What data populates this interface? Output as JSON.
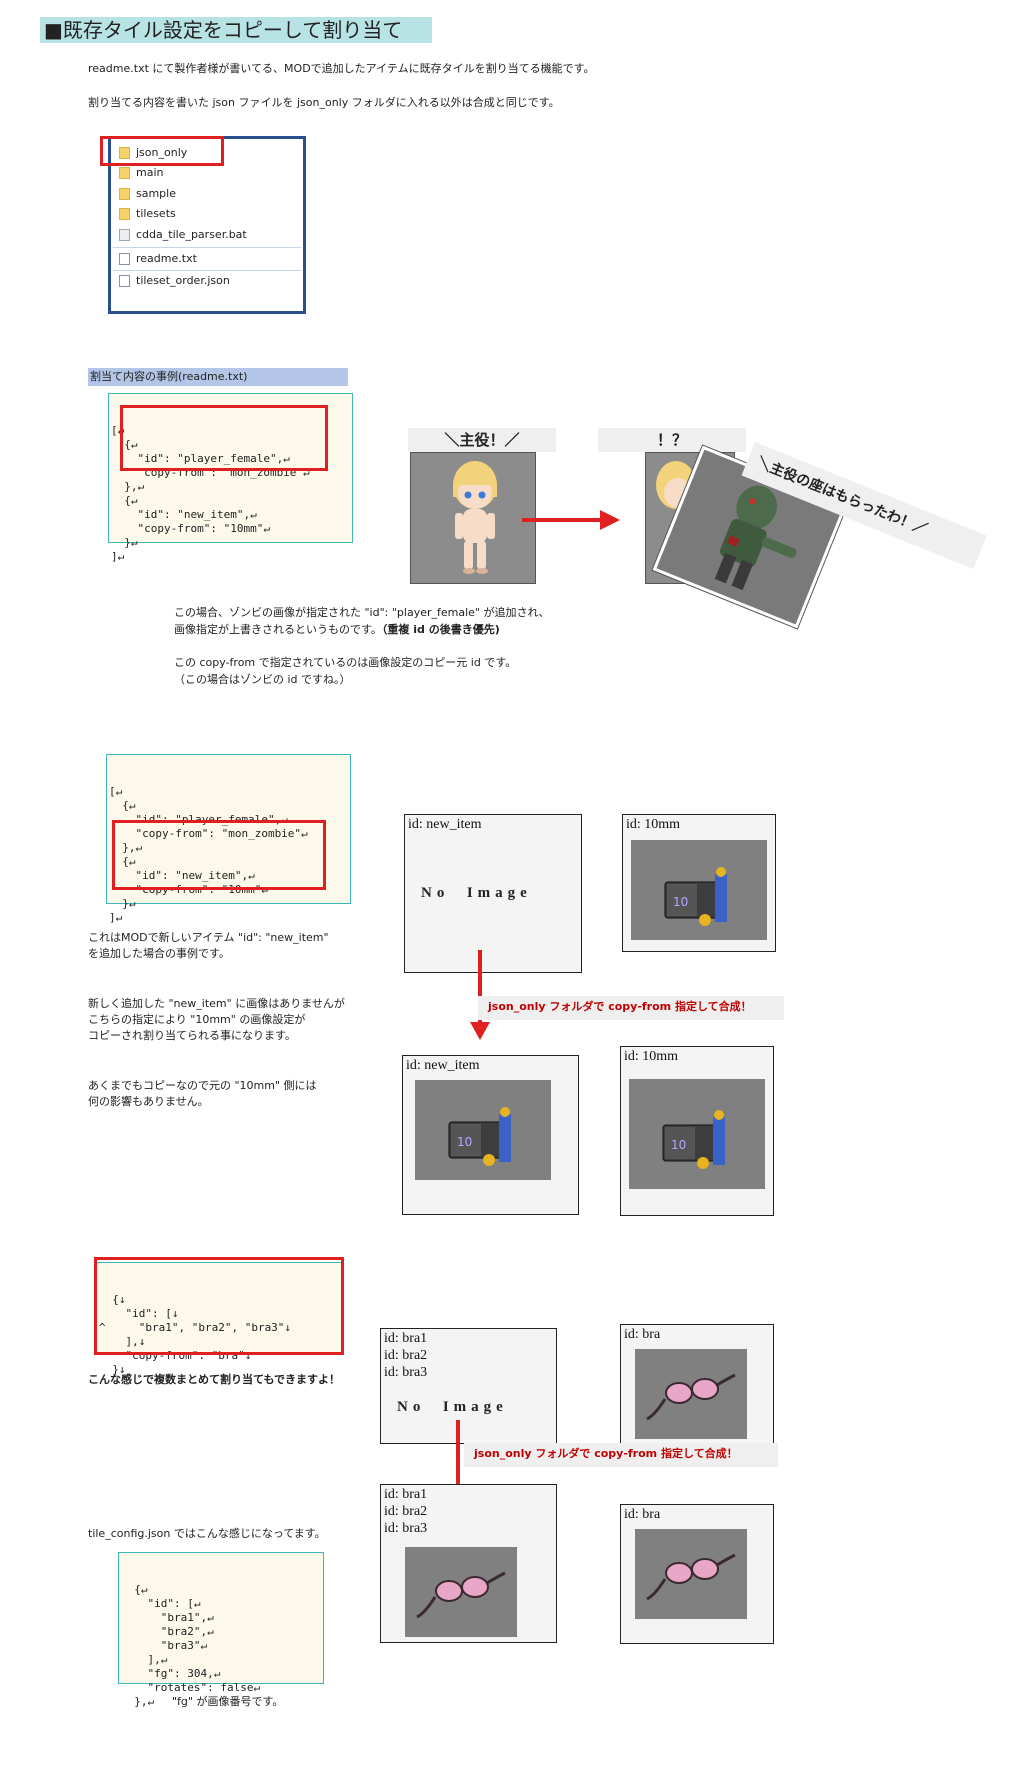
{
  "title": "■既存タイル設定をコピーして割り当て",
  "intro": {
    "line1": "readme.txt にて製作者様が書いてる、MODで追加したアイテムに既存タイルを割り当てる機能です。",
    "line2": "割り当てる内容を書いた json ファイルを json_only フォルダに入れる以外は合成と同じです。"
  },
  "folder": {
    "items": [
      {
        "name": "json_only",
        "icon": "folder-icon"
      },
      {
        "name": "main",
        "icon": "folder-icon"
      },
      {
        "name": "sample",
        "icon": "folder-icon"
      },
      {
        "name": "tilesets",
        "icon": "folder-icon"
      },
      {
        "name": "cdda_tile_parser.bat",
        "icon": "batch-file-icon"
      },
      {
        "name": "readme.txt",
        "icon": "text-file-icon"
      },
      {
        "name": "tileset_order.json",
        "icon": "json-file-icon"
      }
    ]
  },
  "section1": {
    "heading": "割当て内容の事例(readme.txt)",
    "code": [
      "[↵",
      "  {↵",
      "    \"id\": \"player_female\",↵",
      "    \"copy-from\": \"mon_zombie\"↵",
      "  },↵",
      "  {↵",
      "    \"id\": \"new_item\",↵",
      "    \"copy-from\": \"10mm\"↵",
      "  }↵",
      "]↵"
    ],
    "banner_left": "＼主役！／",
    "banner_right": "！？",
    "banner_tilted": "＼主役の座はもらったわ！／",
    "explain": [
      "この場合、ゾンビの画像が指定された \"id\": \"player_female\" が追加され、",
      "画像指定が上書きされるというものです。",
      "（重複 id の後書き優先)",
      "この copy-from で指定されているのは画像設定のコピー元 id です。",
      "（この場合はゾンビの id ですね。）"
    ]
  },
  "section2": {
    "code": [
      "[↵",
      "  {↵",
      "    \"id\": \"player_female\",↵",
      "    \"copy-from\": \"mon_zombie\"↵",
      "  },↵",
      "  {↵",
      "    \"id\": \"new_item\",↵",
      "    \"copy-from\": \"10mm\"↵",
      "  }↵",
      "]↵"
    ],
    "explain": [
      "これはMODで新しいアイテム \"id\": \"new_item\"",
      "を追加した場合の事例です。",
      "新しく追加した \"new_item\" に画像はありませんが",
      "こちらの指定により \"10mm\" の画像設定が",
      "コピーされ割り当てられる事になります。",
      "あくまでもコピーなので元の \"10mm\" 側には",
      "何の影響もありません。"
    ],
    "panel_new_item": "id: new_item",
    "panel_10mm": "id: 10mm",
    "no_image": "No  Image",
    "merge_note": "json_only フォルダで copy-from 指定して合成！"
  },
  "section3": {
    "code": [
      "  {↓",
      "    \"id\": [↓",
      "^     \"bra1\", \"bra2\", \"bra3\"↓",
      "    ],↓",
      "    \"copy-from\": \"bra\"↓",
      "  }↓"
    ],
    "note": "こんな感じで複数まとめて割り当てもできますよ！",
    "panel_ids": "id: bra1\nid: bra2\nid: bra3",
    "panel_bra": "id: bra",
    "no_image": "No  Image",
    "merge_note": "json_only フォルダで copy-from 指定して合成！",
    "config_label": "tile_config.json ではこんな感じになってます。",
    "config_code": [
      "  {↵",
      "    \"id\": [↵",
      "      \"bra1\",↵",
      "      \"bra2\",↵",
      "      \"bra3\"↵",
      "    ],↵",
      "    \"fg\": 304,↵",
      "    \"rotates\": false↵",
      "  },↵"
    ],
    "fg_note": "\"fg\" が画像番号です。"
  },
  "colors": {
    "title_bg": "#b7e3e4",
    "subhead_bg": "#b3c6e7",
    "highlight_red": "#e02020",
    "folder_border": "#2b4f8e",
    "code_border": "#3fb5b5",
    "arrow_red": "#e02020"
  }
}
